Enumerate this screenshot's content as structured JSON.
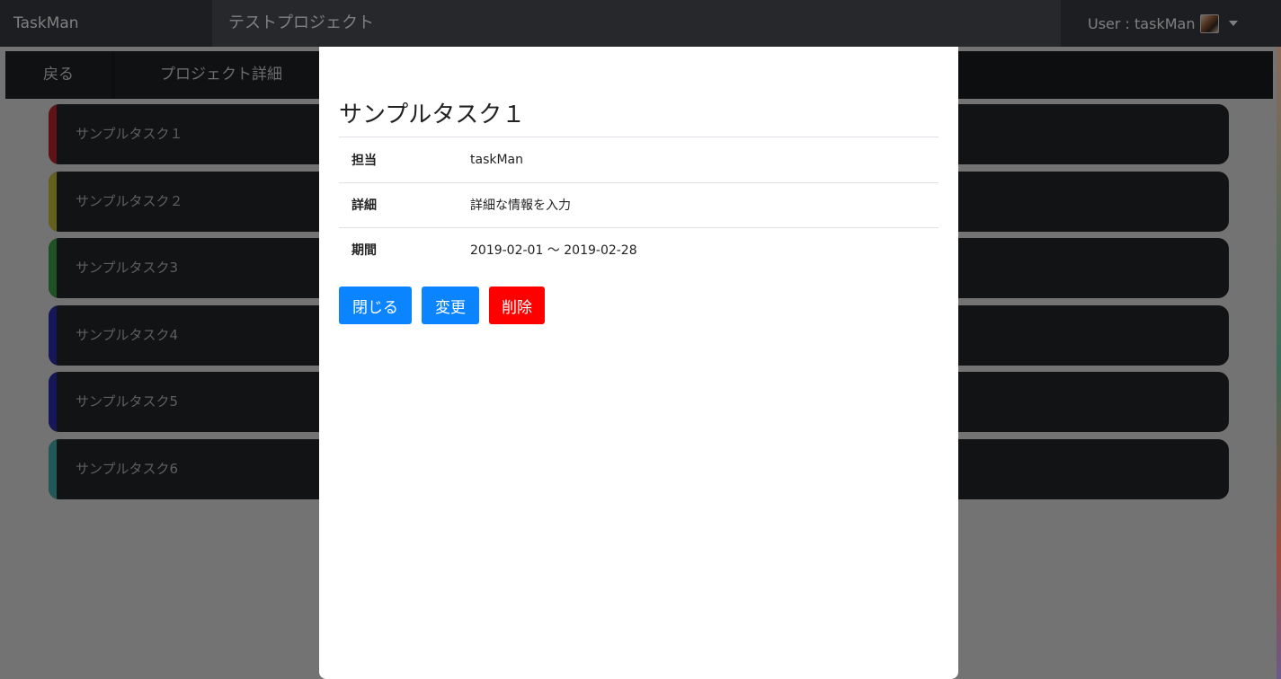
{
  "navbar": {
    "brand": "TaskMan",
    "project_title": "テストプロジェクト",
    "user_label": "User : taskMan"
  },
  "subnav": {
    "back_label": "戻る",
    "detail_label": "プロジェクト詳細"
  },
  "tasks": [
    {
      "label": "サンプルタスク１",
      "color": "#c0262c"
    },
    {
      "label": "サンプルタスク２",
      "color": "#c9c33a"
    },
    {
      "label": "サンプルタスク3",
      "color": "#3fa447"
    },
    {
      "label": "サンプルタスク4",
      "color": "#2a2fb0"
    },
    {
      "label": "サンプルタスク5",
      "color": "#2a2fb0"
    },
    {
      "label": "サンプルタスク6",
      "color": "#46b0b0"
    }
  ],
  "modal": {
    "title": "サンプルタスク１",
    "rows": [
      {
        "key": "担当",
        "value": "taskMan"
      },
      {
        "key": "詳細",
        "value": "詳細な情報を入力"
      },
      {
        "key": "期間",
        "value": "2019-02-01 〜 2019-02-28"
      }
    ],
    "buttons": {
      "close": "閉じる",
      "edit": "変更",
      "delete": "削除"
    }
  }
}
